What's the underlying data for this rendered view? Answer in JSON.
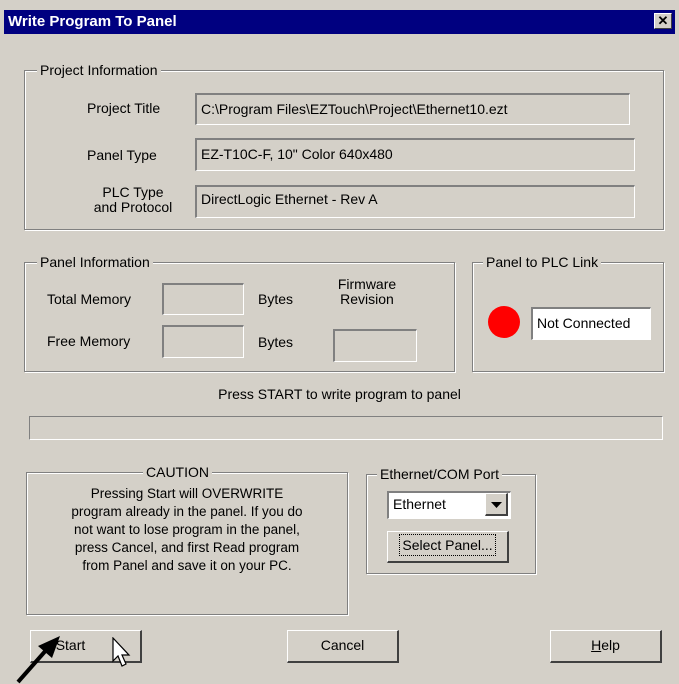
{
  "window": {
    "title": "Write Program To Panel",
    "close_glyph": "✕"
  },
  "project_info": {
    "legend": "Project Information",
    "title_label": "Project Title",
    "title_value": "C:\\Program Files\\EZTouch\\Project\\Ethernet10.ezt",
    "panel_type_label": "Panel Type",
    "panel_type_value": "EZ-T10C-F, 10\" Color 640x480",
    "plc_type_label_1": "PLC Type",
    "plc_type_label_2": "and Protocol",
    "plc_type_value": "DirectLogic  Ethernet - Rev A"
  },
  "panel_info": {
    "legend": "Panel Information",
    "total_memory_label": "Total Memory",
    "total_memory_value": "",
    "total_bytes_unit": "Bytes",
    "free_memory_label": "Free Memory",
    "free_memory_value": "",
    "free_bytes_unit": "Bytes",
    "firmware_label_1": "Firmware",
    "firmware_label_2": "Revision",
    "firmware_value": ""
  },
  "plc_link": {
    "legend": "Panel to PLC Link",
    "status": "Not Connected",
    "status_color": "#ff0000"
  },
  "status_message": "Press START to write program to panel",
  "progress_percent": 0,
  "caution": {
    "legend": "CAUTION",
    "lines": [
      "Pressing Start will OVERWRITE",
      "program already in the panel. If you do",
      "not want to lose program in the panel,",
      "press Cancel, and first Read program",
      "from Panel and save it on your PC."
    ]
  },
  "port": {
    "legend": "Ethernet/COM Port",
    "selected": "Ethernet",
    "select_panel_label": "Select Panel..."
  },
  "buttons": {
    "start": "Start",
    "cancel": "Cancel",
    "help_first": "H",
    "help_rest": "elp"
  },
  "colors": {
    "title_bar": "#000080",
    "face": "#d4d0c8"
  },
  "icons": {
    "dropdown": "dropdown-arrow-icon",
    "cursor": "mouse-pointer-icon",
    "arrow": "annotation-arrow-icon"
  }
}
